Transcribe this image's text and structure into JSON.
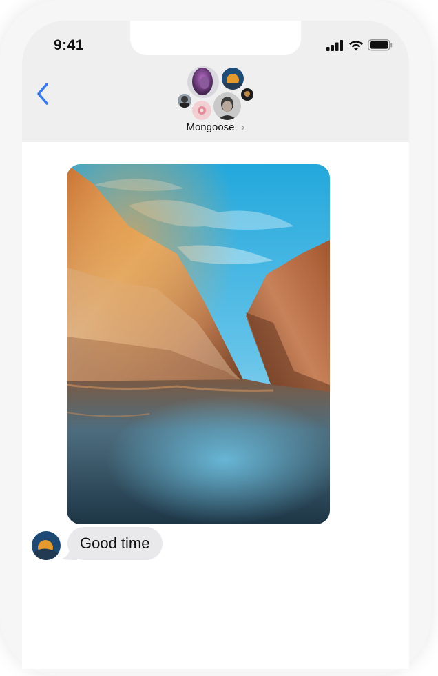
{
  "status_bar": {
    "time": "9:41",
    "icons": [
      "cellular-signal-icon",
      "wifi-icon",
      "battery-icon"
    ]
  },
  "header": {
    "back_icon": "chevron-left-icon",
    "group_name": "Mongoose",
    "group_chevron": "›",
    "participant_avatars": [
      "avatar-purple-woman",
      "avatar-sunset-bird",
      "avatar-small-dark",
      "avatar-glasses-man",
      "avatar-pink-flower",
      "avatar-man-portrait"
    ]
  },
  "messages": [
    {
      "type": "image",
      "content": "canyon-river-photo"
    },
    {
      "type": "text",
      "text": "Good time"
    }
  ],
  "colors": {
    "accent": "#3478f6",
    "nav_background": "#efeff0",
    "bubble_background": "#e9e9eb"
  }
}
